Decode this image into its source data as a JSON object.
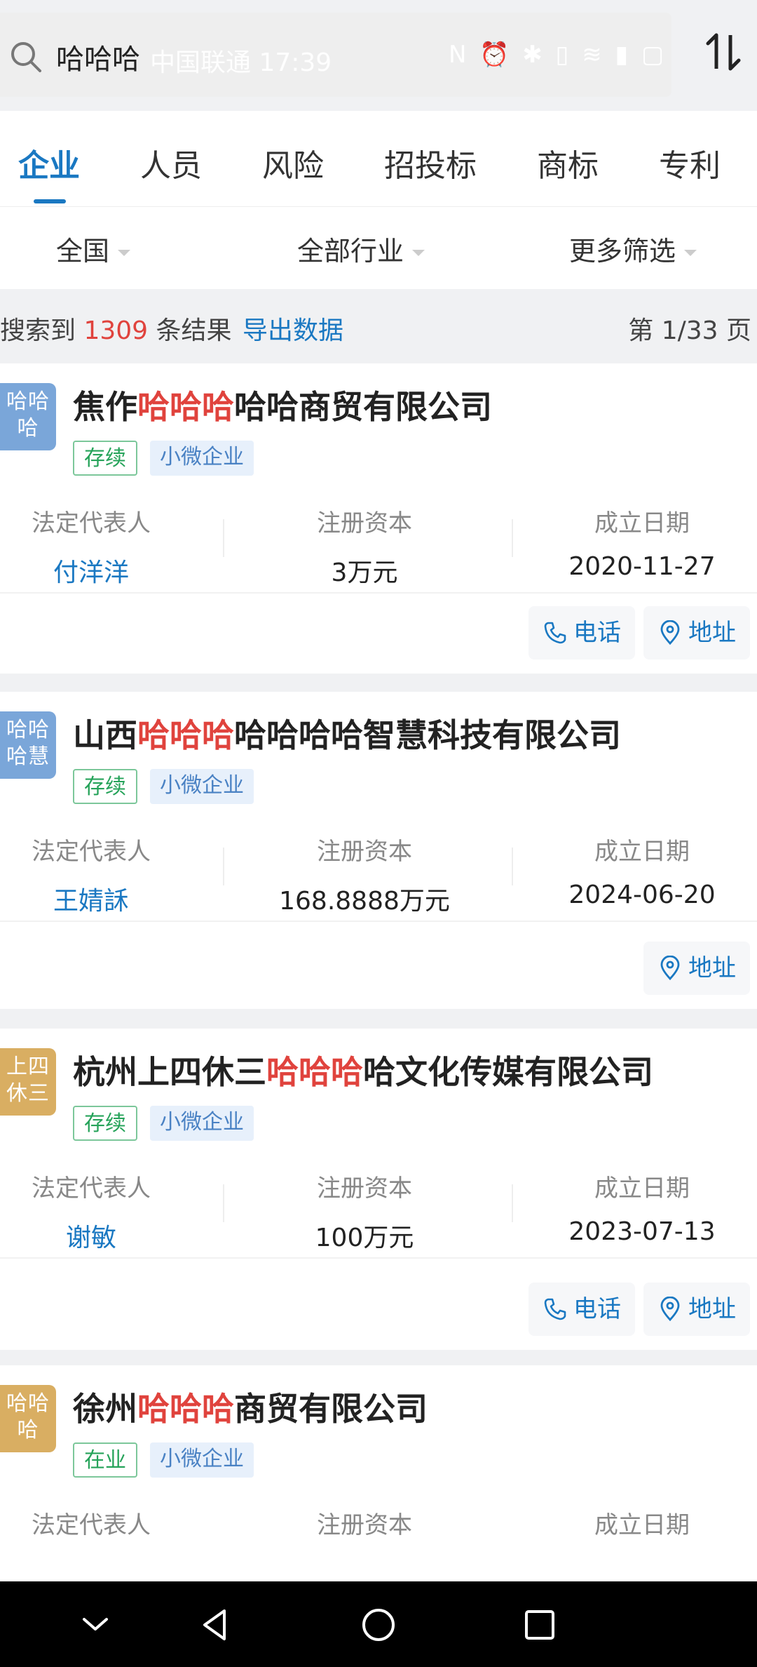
{
  "search": {
    "value": "哈哈哈"
  },
  "status_bar": {
    "carrier": "中国联通 17:39",
    "icons": "N ⏰ ✱ ▯ ≋ ▮ ▢"
  },
  "tabs": [
    {
      "label": "企业",
      "active": true
    },
    {
      "label": "人员",
      "active": false
    },
    {
      "label": "风险",
      "active": false
    },
    {
      "label": "招投标",
      "active": false
    },
    {
      "label": "商标",
      "active": false
    },
    {
      "label": "专利",
      "active": false
    }
  ],
  "filters": [
    {
      "label": "全国"
    },
    {
      "label": "全部行业"
    },
    {
      "label": "更多筛选"
    }
  ],
  "results": {
    "prefix": "搜索到",
    "count": "1309",
    "suffix": "条结果",
    "export_label": "导出数据",
    "page_indicator": "第 1/33 页"
  },
  "info_labels": {
    "legal_rep": "法定代表人",
    "capital": "注册资本",
    "founded": "成立日期"
  },
  "actions": {
    "phone": "电话",
    "address": "地址"
  },
  "companies": [
    {
      "logo": [
        "哈哈",
        "哈"
      ],
      "logo_color": "#7aa6d9",
      "name_pre": "焦作",
      "name_hl": "哈哈哈",
      "name_post": "哈哈商贸有限公司",
      "status": "存续",
      "size": "小微企业",
      "legal_rep": "付洋洋",
      "capital": "3万元",
      "founded": "2020-11-27",
      "has_phone": true,
      "has_address": true
    },
    {
      "logo": [
        "哈哈",
        "哈慧"
      ],
      "logo_color": "#7aa6d9",
      "name_pre": "山西",
      "name_hl": "哈哈哈",
      "name_post": "哈哈哈哈智慧科技有限公司",
      "status": "存续",
      "size": "小微企业",
      "legal_rep": "王婧訸",
      "capital": "168.8888万元",
      "founded": "2024-06-20",
      "has_phone": false,
      "has_address": true
    },
    {
      "logo": [
        "上四",
        "休三"
      ],
      "logo_color": "#d9ae62",
      "name_pre": "杭州上四休三",
      "name_hl": "哈哈哈",
      "name_post": "哈文化传媒有限公司",
      "status": "存续",
      "size": "小微企业",
      "legal_rep": "谢敏",
      "capital": "100万元",
      "founded": "2023-07-13",
      "has_phone": true,
      "has_address": true
    },
    {
      "logo": [
        "哈哈",
        "哈"
      ],
      "logo_color": "#d9ae62",
      "name_pre": "徐州",
      "name_hl": "哈哈哈",
      "name_post": "商贸有限公司",
      "status": "在业",
      "size": "小微企业",
      "legal_rep": "",
      "capital": "",
      "founded": "",
      "has_phone": false,
      "has_address": false
    }
  ],
  "colors": {
    "accent": "#1a78c2",
    "highlight": "#e0433d",
    "status_green": "#26a35a"
  }
}
